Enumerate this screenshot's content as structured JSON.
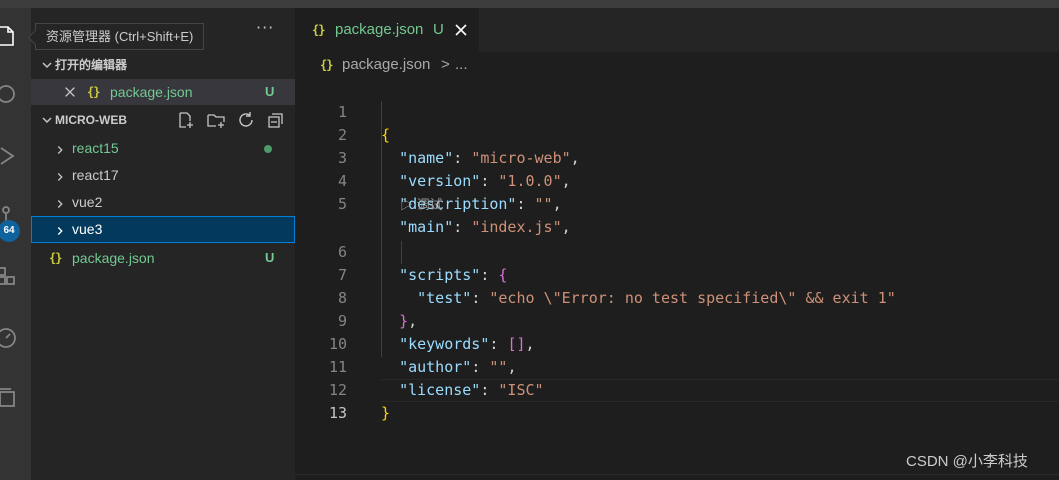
{
  "tooltip": "资源管理器 (Ctrl+Shift+E)",
  "activity": {
    "badge": "64"
  },
  "sidebar": {
    "more": "···",
    "open_editors": {
      "title": "打开的编辑器",
      "items": [
        {
          "icon": "{}",
          "name": "package.json",
          "status": "U"
        }
      ]
    },
    "folder": {
      "title": "MICRO-WEB",
      "items": [
        {
          "name": "react15"
        },
        {
          "name": "react17"
        },
        {
          "name": "vue2"
        },
        {
          "name": "vue3"
        },
        {
          "icon": "{}",
          "name": "package.json",
          "status": "U"
        }
      ]
    }
  },
  "editor": {
    "tab": {
      "icon": "{}",
      "label": "package.json",
      "status": "U"
    },
    "breadcrumb": {
      "icon": "{}",
      "file": "package.json",
      "sep": ">",
      "more": "..."
    },
    "codelens": "调试",
    "line_numbers": [
      "1",
      "2",
      "3",
      "4",
      "5",
      "6",
      "7",
      "8",
      "9",
      "10",
      "11",
      "12",
      "13"
    ],
    "code": {
      "l1": "{",
      "name_key": "\"name\"",
      "name_val": "\"micro-web\"",
      "version_key": "\"version\"",
      "version_val": "\"1.0.0\"",
      "desc_key": "\"description\"",
      "desc_val": "\"\"",
      "main_key": "\"main\"",
      "main_val": "\"index.js\"",
      "scripts_key": "\"scripts\"",
      "test_key": "\"test\"",
      "test_val": "\"echo \\\"Error: no test specified\\\" && exit 1\"",
      "kw_key": "\"keywords\"",
      "author_key": "\"author\"",
      "author_val": "\"\"",
      "license_key": "\"license\"",
      "license_val": "\"ISC\""
    }
  },
  "watermark": "CSDN @小李科技"
}
